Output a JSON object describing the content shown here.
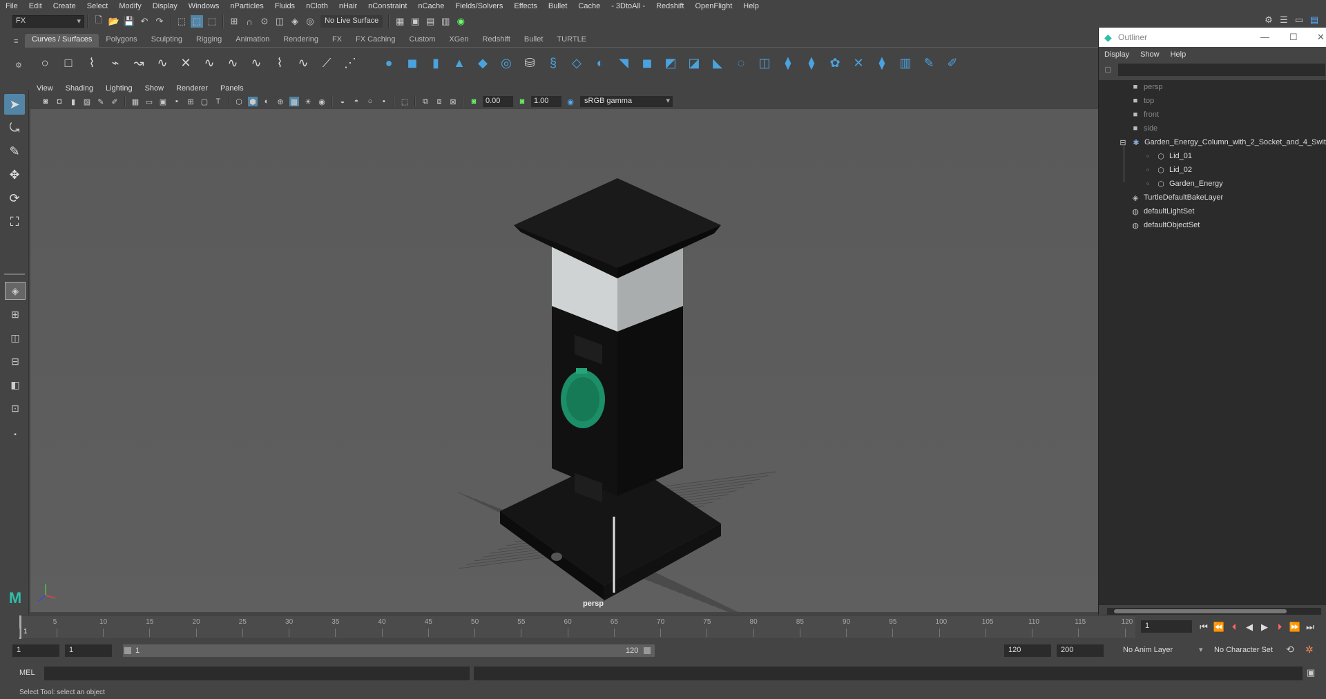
{
  "menubar": [
    "File",
    "Edit",
    "Create",
    "Select",
    "Modify",
    "Display",
    "Windows",
    "nParticles",
    "Fluids",
    "nCloth",
    "nHair",
    "nConstraint",
    "nCache",
    "Fields/Solvers",
    "Effects",
    "Bullet",
    "Cache",
    "- 3DtoAll -",
    "Redshift",
    "OpenFlight",
    "Help"
  ],
  "toolbar": {
    "mode": "FX",
    "live_surface": "No Live Surface"
  },
  "shelf_tabs": [
    "Curves / Surfaces",
    "Polygons",
    "Sculpting",
    "Rigging",
    "Animation",
    "Rendering",
    "FX",
    "FX Caching",
    "Custom",
    "XGen",
    "Redshift",
    "Bullet",
    "TURTLE"
  ],
  "panel_menu": [
    "View",
    "Shading",
    "Lighting",
    "Show",
    "Renderer",
    "Panels"
  ],
  "panel_tools": {
    "exposure": "0.00",
    "gamma_value": "1.00",
    "color_space": "sRGB gamma"
  },
  "viewport": {
    "camera_label": "persp"
  },
  "outliner": {
    "title": "Outliner",
    "menu": [
      "Display",
      "Show",
      "Help"
    ],
    "items": [
      {
        "label": "persp",
        "icon": "camera-icon"
      },
      {
        "label": "top",
        "icon": "camera-icon"
      },
      {
        "label": "front",
        "icon": "camera-icon"
      },
      {
        "label": "side",
        "icon": "camera-icon"
      },
      {
        "label": "Garden_Energy_Column_with_2_Socket_and_4_Swit",
        "icon": "group-icon"
      },
      {
        "label": "Lid_01",
        "icon": "mesh-icon"
      },
      {
        "label": "Lid_02",
        "icon": "mesh-icon"
      },
      {
        "label": "Garden_Energy",
        "icon": "mesh-icon"
      },
      {
        "label": "TurtleDefaultBakeLayer",
        "icon": "layer-icon"
      },
      {
        "label": "defaultLightSet",
        "icon": "set-icon"
      },
      {
        "label": "defaultObjectSet",
        "icon": "set-icon"
      }
    ]
  },
  "timeline": {
    "ticks": [
      "1",
      "5",
      "10",
      "15",
      "20",
      "25",
      "30",
      "35",
      "40",
      "45",
      "50",
      "55",
      "60",
      "65",
      "70",
      "75",
      "80",
      "85",
      "90",
      "95",
      "100",
      "105",
      "110",
      "115",
      "120"
    ],
    "current_frame": "1",
    "current_frame_field": "1"
  },
  "range": {
    "start_field": "1",
    "playback_start": "1",
    "slider_start": "1",
    "slider_end": "120",
    "playback_end": "120",
    "end_field": "200",
    "anim_layer": "No Anim Layer",
    "character_set": "No Character Set"
  },
  "mel": {
    "label": "MEL"
  },
  "status": {
    "text": "Select Tool: select an object"
  }
}
